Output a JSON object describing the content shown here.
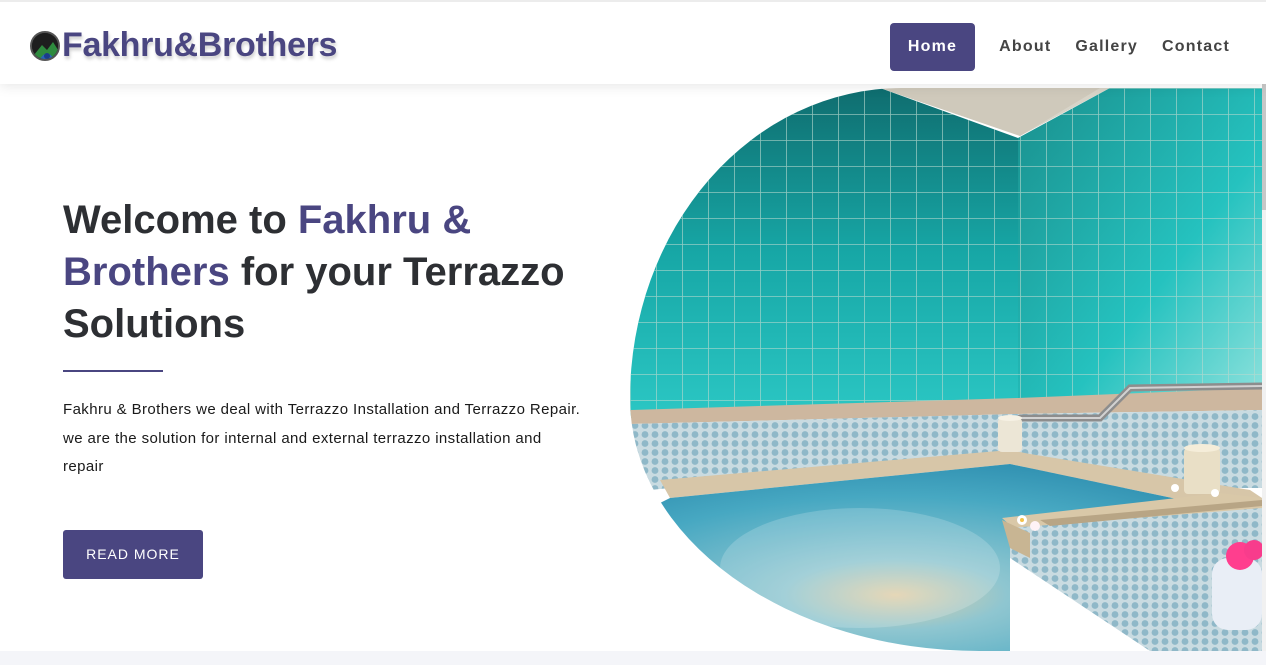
{
  "brand": {
    "name": "Fakhru&Brothers",
    "logo_icon": "mountain-logo-icon"
  },
  "nav": {
    "items": [
      {
        "label": "Home",
        "active": true
      },
      {
        "label": "About",
        "active": false
      },
      {
        "label": "Gallery",
        "active": false
      },
      {
        "label": "Contact",
        "active": false
      }
    ]
  },
  "hero": {
    "title_part1": "Welcome to ",
    "title_accent": "Fakhru & Brothers",
    "title_part2": " for your Terrazzo Solutions",
    "description": "Fakhru & Brothers we deal with Terrazzo Installation and Terrazzo Repair. we are the solution for internal and external terrazzo installation and repair",
    "button_label": "READ MORE",
    "image": "indoor-pool-photo"
  },
  "colors": {
    "accent": "#4a4681",
    "heading": "#2d2f33",
    "pool": "#1bb4b6"
  }
}
